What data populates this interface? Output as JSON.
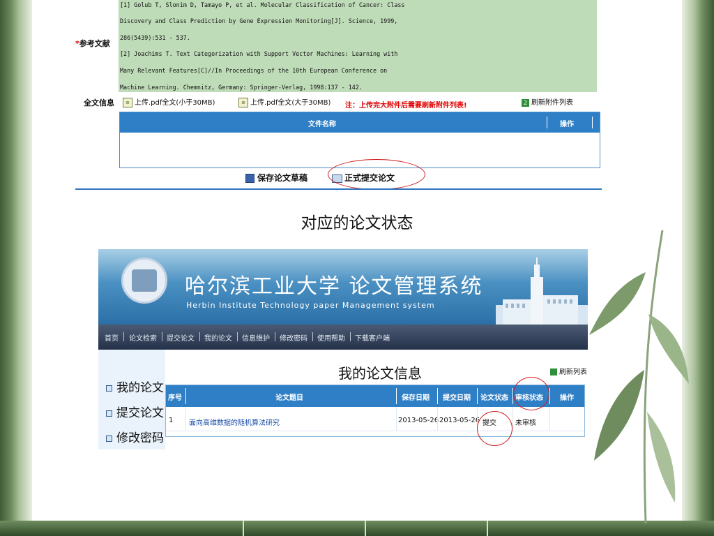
{
  "form": {
    "references_label": "参考文献",
    "required_mark": "*",
    "reference_lines": [
      "[1] Golub T, Slonim D, Tamayo P, et al. Molecular Classification of Cancer: Class",
      "Discovery and Class Prediction by Gene Expression Monitoring[J]. Science, 1999,",
      "286(5439):531 - 537.",
      "[2] Joachims T. Text Categorization with Support Vector Machines: Learning with",
      "Many Relevant Features[C]//In Proceedings of the 10th European Conference on",
      "Machine Learning. Chemnitz, Germany: Springer-Verlag, 1998:137 - 142."
    ],
    "fulltext_label": "全文信息",
    "upload_small": "上传.pdf全文(小于30MB)",
    "upload_large": "上传.pdf全文(大于30MB)",
    "upload_note": "注：上传完大附件后需要刷新附件列表!",
    "refresh_attachments": "刷新附件列表",
    "file_table": {
      "col_name": "文件名称",
      "col_action": "操作"
    },
    "save_draft": "保存论文草稿",
    "formal_submit": "正式提交论文"
  },
  "caption": "对应的论文状态",
  "system": {
    "title": "哈尔滨工业大学 论文管理系统",
    "subtitle": "Herbin Institute Technology paper Management system",
    "nav": [
      "首页",
      "论文检索",
      "提交论文",
      "我的论文",
      "信息维护",
      "修改密码",
      "使用帮助",
      "下载客户端"
    ],
    "menu": [
      "我的论文",
      "提交论文",
      "修改密码"
    ],
    "content_title": "我的论文信息",
    "refresh_list": "刷新列表",
    "table": {
      "headers": [
        "序号",
        "论文题目",
        "保存日期",
        "提交日期",
        "论文状态",
        "审核状态",
        "操作"
      ],
      "rows": [
        {
          "no": "1",
          "title": "面向高维数据的随机算法研究",
          "save_date": "2013-05-26",
          "submit_date": "2013-05-26",
          "status": "提交",
          "review": "未审核",
          "action": ""
        }
      ]
    }
  },
  "colors": {
    "accent_blue": "#2f7fc6",
    "highlight_red": "#d01a1a",
    "ref_bg": "#bfdcb8"
  }
}
